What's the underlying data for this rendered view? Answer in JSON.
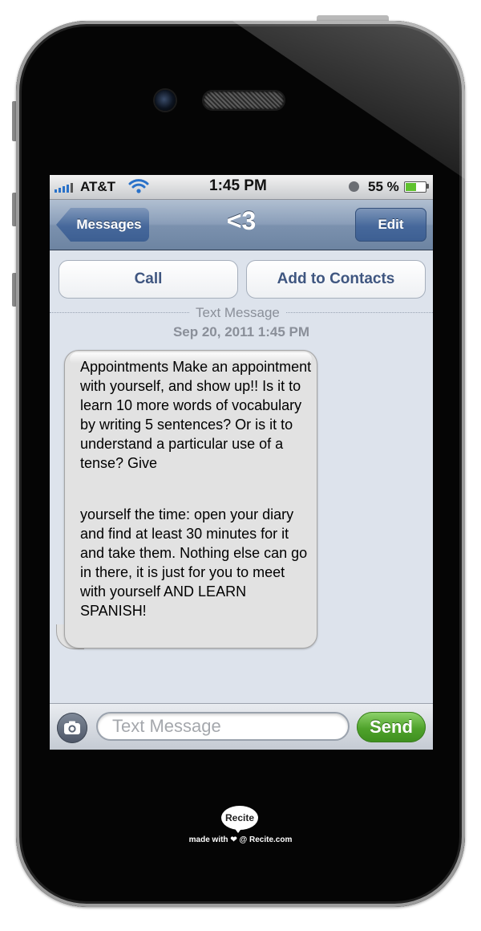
{
  "status_bar": {
    "carrier": "AT&T",
    "time": "1:45 PM",
    "battery": "55 %",
    "battery_level": 0.55
  },
  "nav": {
    "back_label": "Messages",
    "title": "<3",
    "edit_label": "Edit"
  },
  "actions": {
    "call_label": "Call",
    "add_label": "Add to Contacts"
  },
  "thread": {
    "label": "Text Message",
    "timestamp": "Sep 20, 2011 1:45 PM",
    "message": {
      "part1": "Appointments Make an appointment with yourself, and show up!! Is it to learn 10 more words of vocabulary by writing 5 sentences? Or is it to understand a particular use of a tense? Give",
      "part2": "yourself the time: open your diary and find at least 30 minutes for it and take them. Nothing else can go in there, it is just for you to meet with yourself AND LEARN SPANISH!"
    }
  },
  "input": {
    "placeholder": "Text Message",
    "send_label": "Send"
  },
  "footer": {
    "logo_text": "Recite",
    "credit": "made with ❤ @ Recite.com"
  },
  "colors": {
    "nav_blue": "#6d84a2",
    "send_green": "#4fa22b",
    "link_blue": "#3f5680"
  }
}
